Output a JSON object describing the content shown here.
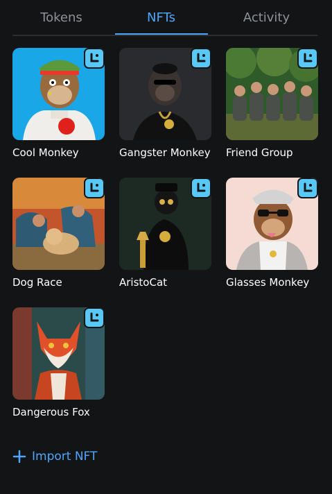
{
  "tabs": [
    {
      "label": "Tokens",
      "active": false
    },
    {
      "label": "NFTs",
      "active": true
    },
    {
      "label": "Activity",
      "active": false
    }
  ],
  "colors": {
    "accent": "#4ea7ff",
    "badge": "#58c8f6",
    "background": "#131416"
  },
  "nfts": [
    {
      "name": "Cool Monkey",
      "badge_icon": "collectible-badge-icon"
    },
    {
      "name": "Gangster Monkey",
      "badge_icon": "collectible-badge-icon"
    },
    {
      "name": "Friend Group",
      "badge_icon": "collectible-badge-icon"
    },
    {
      "name": "Dog Race",
      "badge_icon": "collectible-badge-icon"
    },
    {
      "name": "AristoCat",
      "badge_icon": "collectible-badge-icon"
    },
    {
      "name": "Glasses Monkey",
      "badge_icon": "collectible-badge-icon"
    },
    {
      "name": "Dangerous Fox",
      "badge_icon": "collectible-badge-icon"
    }
  ],
  "import_button": {
    "icon": "plus-icon",
    "label": "Import NFT"
  }
}
